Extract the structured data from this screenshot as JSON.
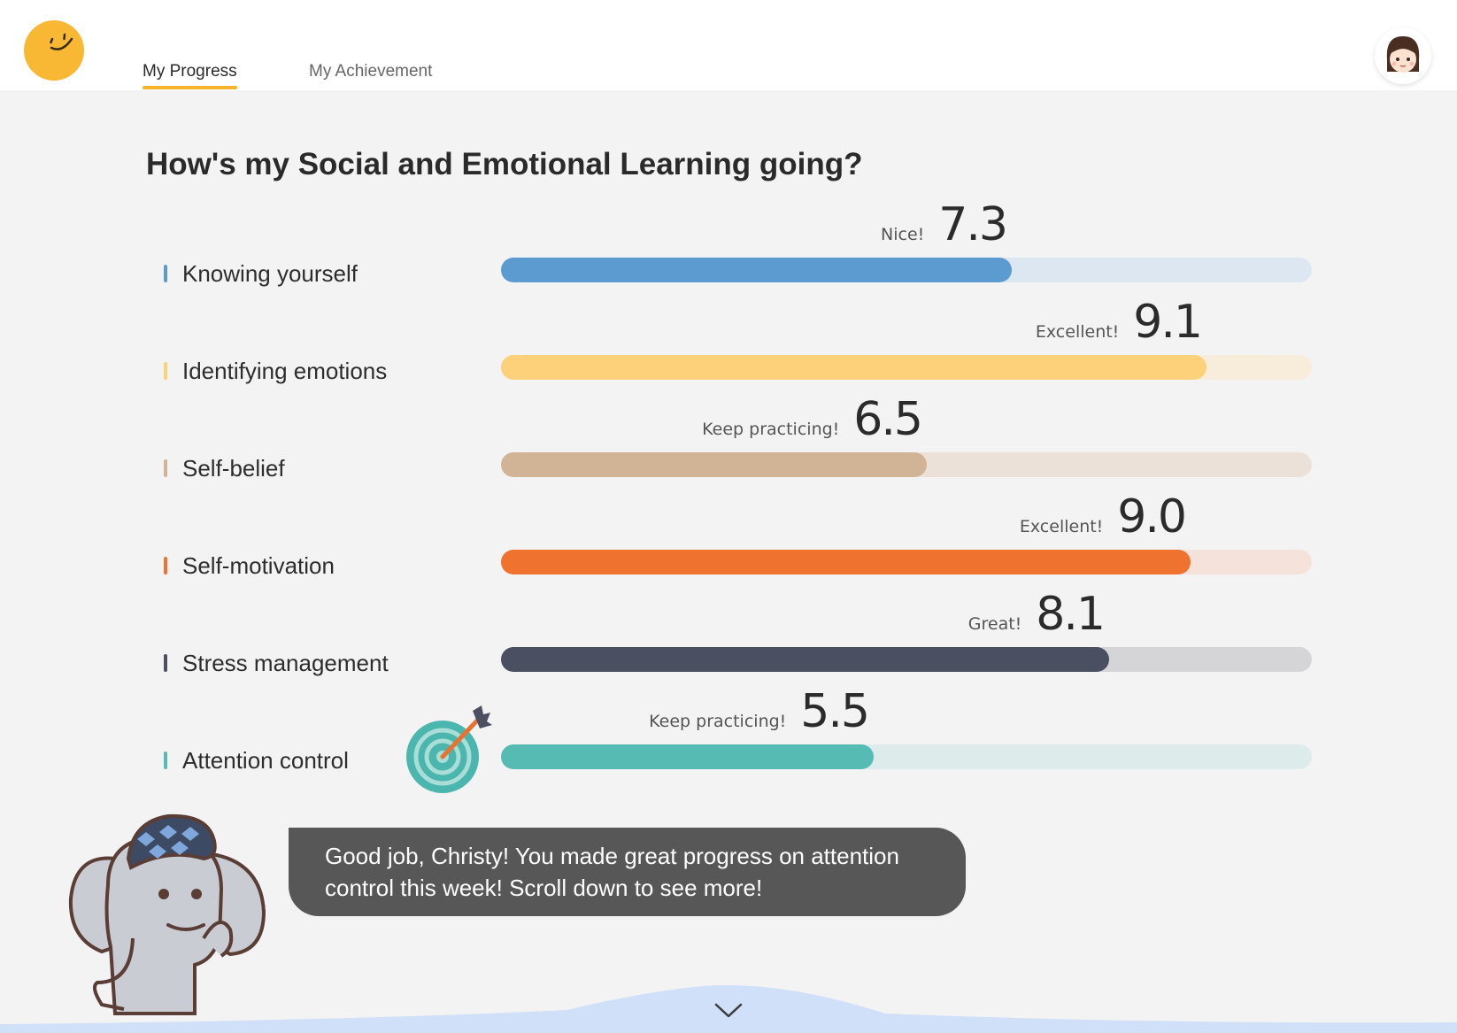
{
  "header": {
    "tabs": [
      {
        "label": "My Progress",
        "active": true
      },
      {
        "label": "My Achievement",
        "active": false
      }
    ]
  },
  "main": {
    "title": "How's my Social and Emotional Learning going?",
    "skills": [
      {
        "label": "Knowing yourself",
        "praise": "Nice!",
        "score": "7.3",
        "fill_percent": 63,
        "color": "#5b9bd0",
        "track_color": "#dce7f2"
      },
      {
        "label": "Identifying emotions",
        "praise": "Excellent!",
        "score": "9.1",
        "fill_percent": 87,
        "color": "#fdd07a",
        "track_color": "#f8eddb"
      },
      {
        "label": "Self-belief",
        "praise": "Keep practicing!",
        "score": "6.5",
        "fill_percent": 52.5,
        "color": "#d1b495",
        "track_color": "#ebe1d9"
      },
      {
        "label": "Self-motivation",
        "praise": "Excellent!",
        "score": "9.0",
        "fill_percent": 85,
        "color": "#ef722f",
        "track_color": "#f5e2db"
      },
      {
        "label": "Stress management",
        "praise": "Great!",
        "score": "8.1",
        "fill_percent": 75,
        "color": "#4a4f62",
        "track_color": "#d5d5d8"
      },
      {
        "label": "Attention control",
        "praise": "Keep practicing!",
        "score": "5.5",
        "fill_percent": 46,
        "color": "#55bbb3",
        "track_color": "#ddeceb"
      }
    ]
  },
  "mascot": {
    "message": "Good job, Christy! You made great progress on attention control this week! Scroll down to see more!"
  },
  "icons": {
    "logo": "smiley-logo-icon",
    "avatar": "girl-avatar-icon",
    "target": "target-arrow-icon",
    "scroll": "chevron-down-icon"
  },
  "colors": {
    "accent": "#f4b52a",
    "speech_bubble": "#575757",
    "background": "#f3f3f3"
  }
}
